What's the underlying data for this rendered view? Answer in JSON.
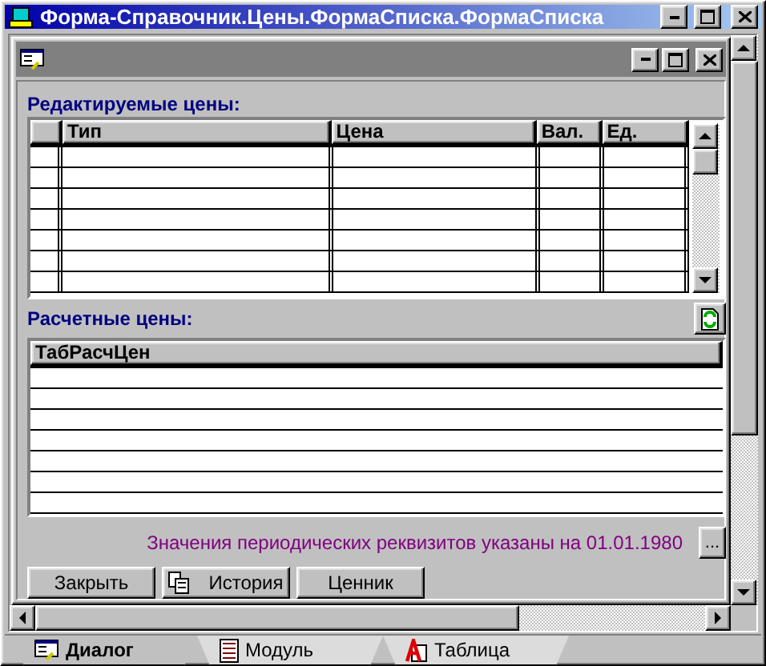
{
  "window": {
    "title": "Форма-Справочник.Цены.ФормаСписка.ФормаСписка"
  },
  "editable_prices": {
    "label": "Редактируемые цены:",
    "columns": [
      "Тип",
      "Цена",
      "Вал.",
      "Ед."
    ]
  },
  "calculated_prices": {
    "label": "Расчетные цены:",
    "columns": [
      "ТабРасчЦен"
    ]
  },
  "info": {
    "text": "Значения периодических реквизитов указаны на 01.01.1980",
    "button": "..."
  },
  "buttons": [
    {
      "label": "Закрыть",
      "kind": "plain"
    },
    {
      "label": "История",
      "kind": "icon"
    },
    {
      "label": "Ценник",
      "kind": "plain"
    }
  ],
  "tabs": [
    {
      "label": "Диалог",
      "selected": true,
      "kind": "dialog"
    },
    {
      "label": "Модуль",
      "selected": false,
      "kind": "module"
    },
    {
      "label": "Таблица",
      "selected": false,
      "kind": "table"
    }
  ]
}
